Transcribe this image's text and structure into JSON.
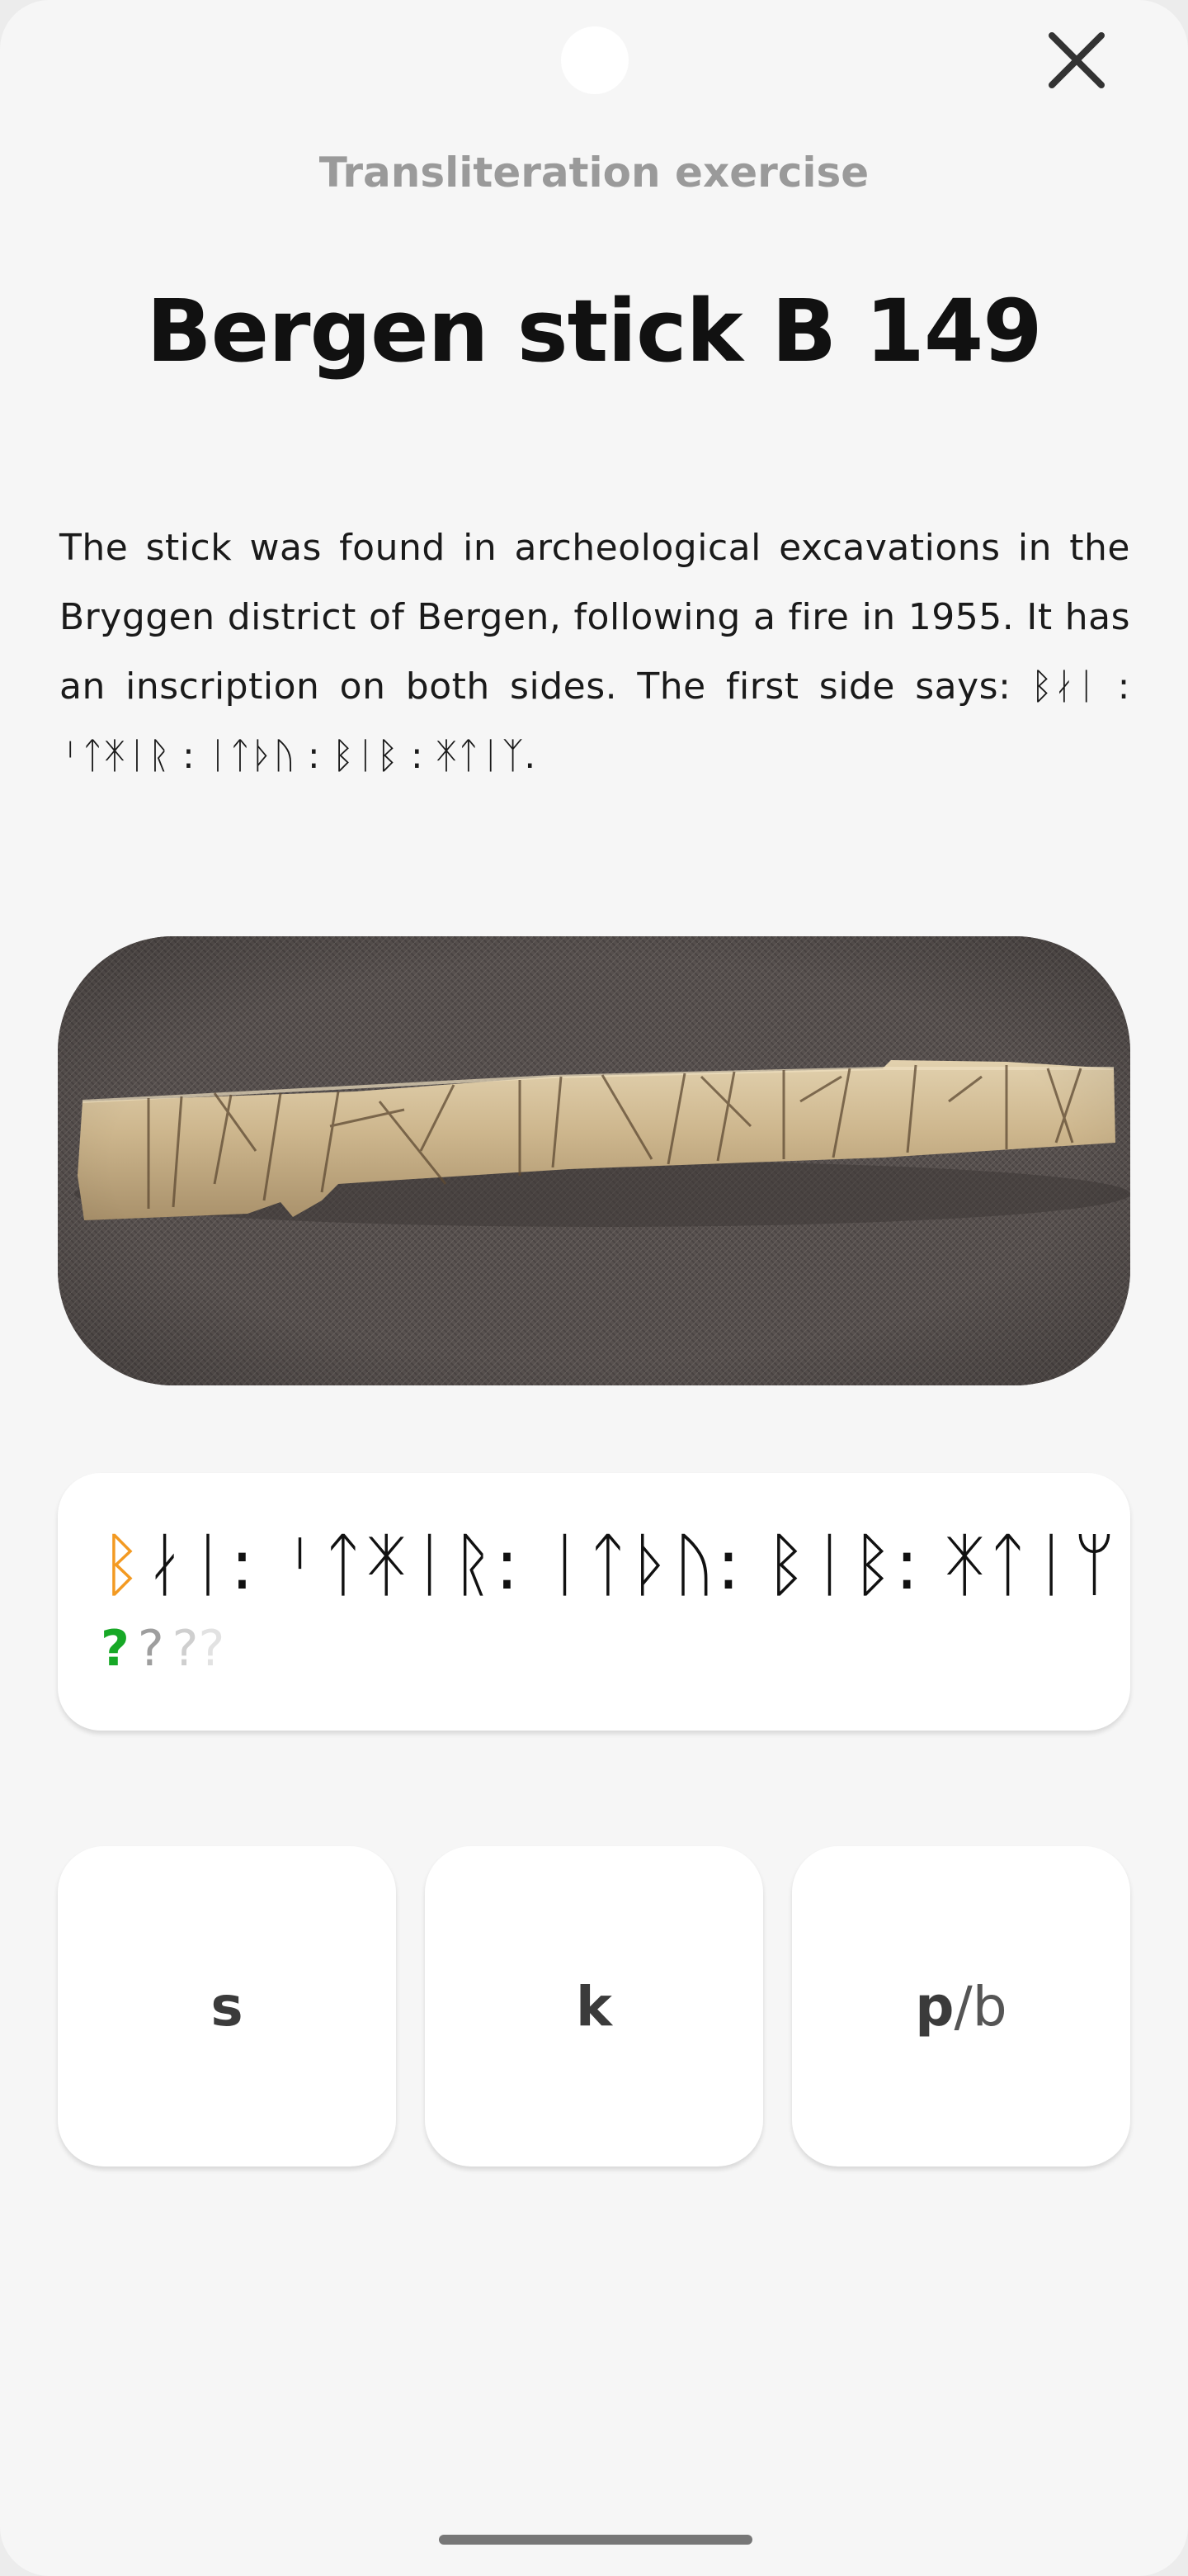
{
  "header": {
    "subtitle": "Transliteration exercise",
    "title": "Bergen stick B 149",
    "close_icon": "close-icon"
  },
  "description": "The stick was found in archeological excavations in the Bryggen district of Bergen, following a fire in 1955. It has an inscription on both sides. The first side says: ᛒᛅᛁ : ᛌᛏᛡᛁᚱ : ᛁᛏᚦᚢ : ᛒᛁᛒ : ᛡᛏᛁᛉ.",
  "photo": {
    "subject": "carved rune stick on dark fabric"
  },
  "transliteration": {
    "current_rune": "ᛒ",
    "remaining_runes": "ᛅᛁ: ᛌᛏᛡᛁᚱ: ᛁᛏᚦᚢ: ᛒᛁᛒ: ᛡᛏᛁᛘ",
    "guesses": [
      "?",
      "?",
      "?",
      "?"
    ]
  },
  "options": [
    {
      "primary": "s",
      "secondary": ""
    },
    {
      "primary": "k",
      "secondary": ""
    },
    {
      "primary": "p",
      "secondary": "/b"
    }
  ],
  "colors": {
    "highlight_rune": "#f39a22",
    "current_guess": "#17a826",
    "background": "#f6f6f6",
    "card": "#ffffff"
  }
}
